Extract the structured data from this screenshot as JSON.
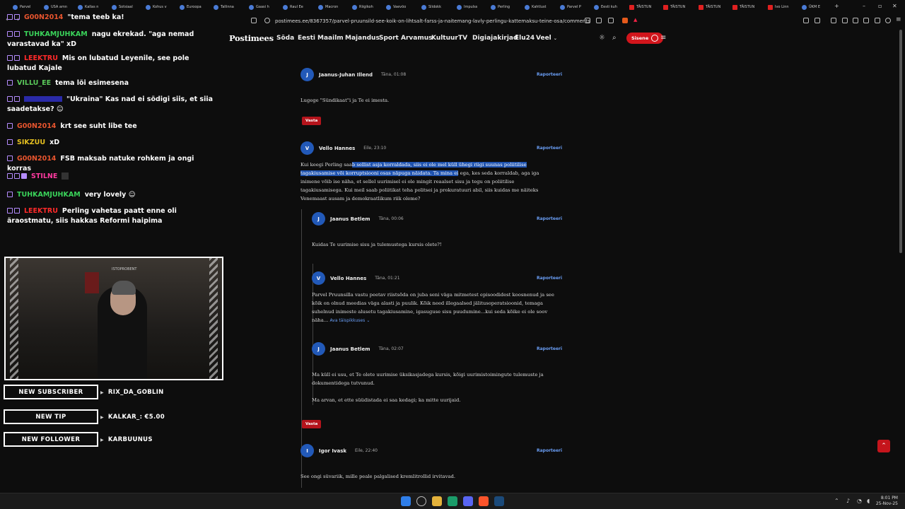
{
  "browser": {
    "tabs": [
      "Parvel",
      "USA amn",
      "Kallas n",
      "Sotsiaal",
      "Kohus v",
      "Euroopa",
      "Tallinna",
      "Gaasi h",
      "Raul Ee",
      "Macron",
      "Riigikoh",
      "Vaevõo",
      "Slidokk",
      "Impulss",
      "Perling",
      "Kahtlust",
      "Parvel P",
      "Eesti kuh",
      "TÄISTUN",
      "TÄISTUN",
      "TÄISTUN",
      "TÄISTUN",
      "Ivo Linn",
      "ÜKM E"
    ],
    "url": "postimees.ee/8367357/parvel-pruunsild-see-koik-on-lihtsalt-farss-ja-naitemang-lavly-perlingu-kattemaksu-teine-osa/comments"
  },
  "stream": {
    "chat": [
      {
        "user": "G00N2014",
        "user_color": "#e8552e",
        "text": "\"tema teeb ka!"
      },
      {
        "user": "TUHKAMJUHKAM",
        "user_color": "#3ad35a",
        "text": "nagu ekrekad. \"aga nemad varastavad ka\" xD"
      },
      {
        "user": "LEEKTRU",
        "user_color": "#ff2a2a",
        "text": "Mis on lubatud Leyenile, see pole lubatud Kajale"
      },
      {
        "user": "VILLU_EE",
        "user_color": "#5ac95a",
        "text": "tema lõi esimesena"
      },
      {
        "user": "",
        "user_color": "#3a3aff",
        "text": "\"Ukraina\" Kas nad ei södigi siis, et siia saadetakse?"
      },
      {
        "user": "G00N2014",
        "user_color": "#e8552e",
        "text": "krt see suht libe tee"
      },
      {
        "user": "SIKZUU",
        "user_color": "#e6c020",
        "text": "xD"
      },
      {
        "user": "G00N2014",
        "user_color": "#e8552e",
        "text": "FSB maksab natuke rohkem ja ongi korras"
      },
      {
        "user": "STILNE",
        "user_color": "#ff3aa0",
        "text": ""
      },
      {
        "user": "TUHKAMJUHKAM",
        "user_color": "#3ad35a",
        "text": "very lovely"
      },
      {
        "user": "LEEKTRU",
        "user_color": "#ff2a2a",
        "text": "Perling vahetas paatt enne oli äraostmatu, siis hakkas Reformi haipima"
      }
    ],
    "webcam_label": "ISTOPROBENT",
    "alerts": [
      {
        "label": "NEW SUBSCRIBER",
        "name": "RIX_DA_GOBLIN"
      },
      {
        "label": "NEW TIP",
        "name": "KALKAR_: €5.00"
      },
      {
        "label": "NEW FOLLOWER",
        "name": "KARBUUNUS"
      }
    ]
  },
  "site": {
    "logo": "Postimees",
    "nav": [
      "Sõda",
      "Eesti",
      "Maailm",
      "Majandus",
      "Sport",
      "Arvamus",
      "Kultuur",
      "TV",
      "Digiajakirjad",
      "Elu24",
      "Veel"
    ],
    "login": "Sisene"
  },
  "comments": {
    "report_label": "Raporteeri",
    "reply_label": "Vasta",
    "items": [
      {
        "initial": "J",
        "author": "Jaanus-Juhan Illend",
        "time": "Täna, 01:08",
        "body": "Lugege \"Sündikaat\"i ja Te ei imesta."
      },
      {
        "initial": "V",
        "author": "Vello Hannes",
        "time": "Eile, 23:10",
        "body_pre": "Kui keegi Perling saa",
        "body_hl": "b sellist asja korraldada, siis ei ole mel küll ühegi riigi suunas poliitilise tagakiusamise või korruptsiooni osas näpuga näidata. Ta mina ei",
        "body_post": " ega, kes seda korraldab, aga iga inimene võib ise näha, et sellel uurimisel ei ole mingit reaalset sisu ja tegu on poliitilise tagakiusamisega. Kui meil saab poliitikat teha politsei ja prokuratuuri abil, siis kuidas me näiteks Venemaast ausam ja demokraatlikum riik oleme?"
      },
      {
        "initial": "J",
        "author": "Jaanus Betlem",
        "time": "Täna, 00:06",
        "body": "Kuidas Te uurimise sisu ja tulemustega kursis olete?!"
      },
      {
        "initial": "V",
        "author": "Vello Hannes",
        "time": "Täna, 01:21",
        "body": "Parvel Pruunsilla vastu peetav riistsõda on juba seni väga mitmetest episoodidest koosnenud ja see kõik on olnud meedias väga alasti ja puulik. Kõik need illegaalsed jälitusoperatsioonid, temaga suhelnud inimeste alusetu tagakiusamine, igasuguse sisu puudumine...kui seda kõike ei ole soov näha...",
        "read_more": "Ava täispikkuses"
      },
      {
        "initial": "J",
        "author": "Jaanus Betlem",
        "time": "Täna, 02:07",
        "body": "Ma küll ei usu, et Te olete uurimise üksikasjadega kursis, kõigi uurimistoimingute tulemuste ja dokumentidega tutvunud.",
        "body2": "Ma arvan, et ette süüdistada ei saa kedagi; ka mitte uurijaid."
      },
      {
        "initial": "I",
        "author": "Igor Ivask",
        "time": "Eile, 22:40",
        "body": "See ongi süvariik, mille peale palgalised kremlitrollid irvitavad."
      }
    ]
  },
  "taskbar": {
    "time": "8:01 PM",
    "date": "25-Nov-25"
  }
}
